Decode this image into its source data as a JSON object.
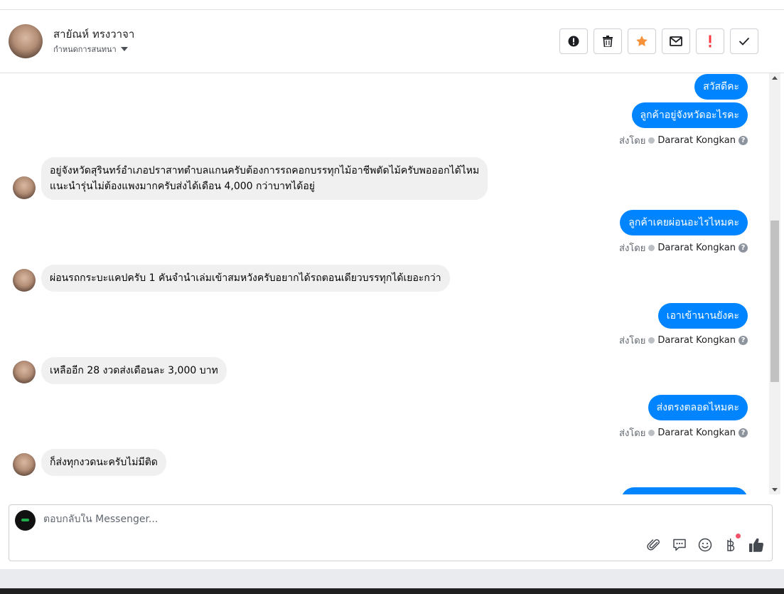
{
  "header": {
    "contact_name": "สายัณห์ ทรงวาจา",
    "conversation_settings": "กำหนดการสนทนา",
    "actions": [
      {
        "name": "alert-icon"
      },
      {
        "name": "trash-icon"
      },
      {
        "name": "star-icon"
      },
      {
        "name": "envelope-icon"
      },
      {
        "name": "exclamation-icon"
      },
      {
        "name": "checkmark-icon"
      }
    ]
  },
  "colors": {
    "outgoing_bubble": "#0084ff",
    "incoming_bubble": "#f0f0f0",
    "star": "#f7923a",
    "alert_red": "#fa383e"
  },
  "messages": [
    {
      "direction": "out",
      "text": "สวัสดีคะ"
    },
    {
      "direction": "out",
      "text": "ลูกค้าอยู่จังหวัดอะไรคะ"
    },
    {
      "direction": "meta",
      "sent_by_label": "ส่งโดย",
      "agent": "Dararat Kongkan"
    },
    {
      "direction": "in",
      "line1": "อยู่จังหวัดสุรินทร์อำเภอปราสาทตำบลแกนครับต้องการรถคอกบรรทุกไม้อาชีพตัดไม้ครับพอออกได้ไหม",
      "line2": "แนะนำรุ่นไม่ต้องแพงมากครับส่งได้เดือน 4,000 กว่าบาทได้อยู่"
    },
    {
      "direction": "out",
      "text": "ลูกค้าเคยผ่อนอะไรไหมคะ"
    },
    {
      "direction": "meta",
      "sent_by_label": "ส่งโดย",
      "agent": "Dararat Kongkan"
    },
    {
      "direction": "in",
      "text": "ผ่อนรถกระบะแคปครับ 1 คันจำนำเล่มเข้าสมหวังครับอยากได้รถตอนเดียวบรรทุกได้เยอะกว่า"
    },
    {
      "direction": "out",
      "text": "เอาเข้านานยังคะ"
    },
    {
      "direction": "meta",
      "sent_by_label": "ส่งโดย",
      "agent": "Dararat Kongkan"
    },
    {
      "direction": "in",
      "text": "เหลืออีก 28 งวดส่งเดือนละ 3,000 บาท"
    },
    {
      "direction": "out",
      "text": "ส่งตรงตลอดไหมคะ"
    },
    {
      "direction": "meta",
      "sent_by_label": "ส่งโดย",
      "agent": "Dararat Kongkan"
    },
    {
      "direction": "in",
      "text": "ก็ส่งทุกงวดนะครับไม่มีติด"
    }
  ],
  "composer": {
    "placeholder": "ตอบกลับใน Messenger...",
    "tools": [
      "paperclip-icon",
      "saved-reply-icon",
      "emoji-icon",
      "baht-icon",
      "thumbs-up-icon"
    ]
  }
}
